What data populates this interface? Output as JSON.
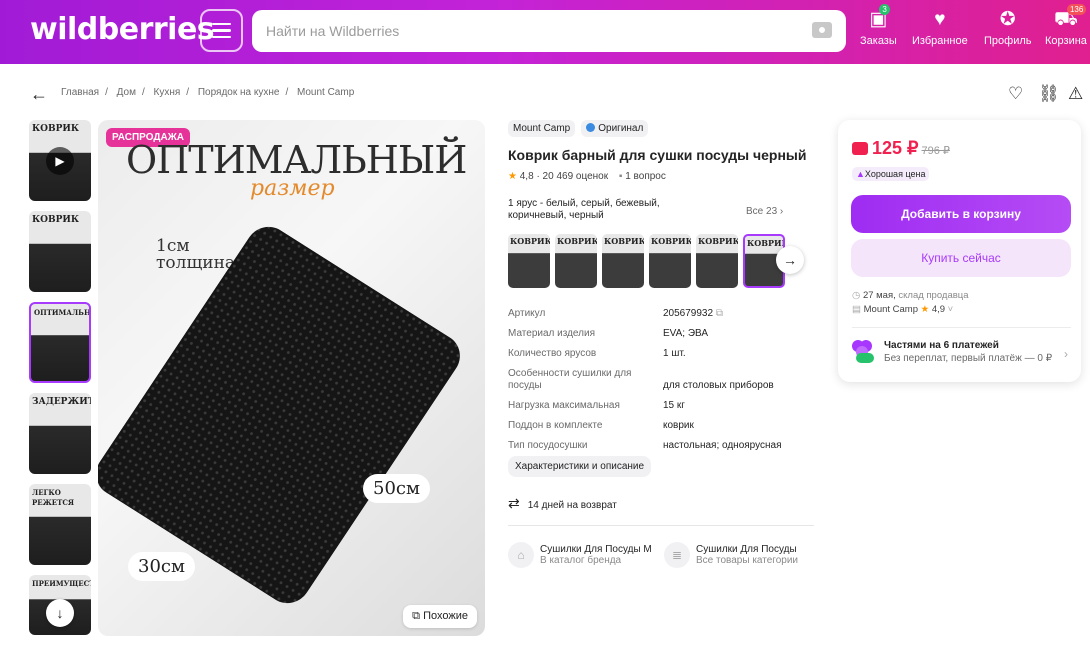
{
  "header": {
    "logo": "wildberries",
    "search_placeholder": "Найти на Wildberries",
    "nav": [
      {
        "label": "Заказы",
        "icon": "box-icon",
        "badge": "3"
      },
      {
        "label": "Избранное",
        "icon": "heart-icon",
        "badge": ""
      },
      {
        "label": "Профиль",
        "icon": "profile-icon",
        "badge": ""
      },
      {
        "label": "Корзина",
        "icon": "cart-icon",
        "badge": "136"
      }
    ]
  },
  "breadcrumbs": [
    "Главная",
    "/",
    "Дом",
    "/",
    "Кухня",
    "/",
    "Порядок на кухне",
    "/",
    "Mount Camp"
  ],
  "gallery": {
    "sale_label": "РАСПРОДАЖА",
    "heading": "ОПТИМАЛЬНЫЙ",
    "subheading": "размер",
    "thickness": "1см",
    "thickness_label": "толщина",
    "dim_long": "50см",
    "dim_short": "30см",
    "similar_label": "Похожие",
    "thumbs": [
      "КОВРИК",
      "КОВРИК",
      "ОПТИМАЛЬНЫЙ",
      "ЗАДЕРЖИТ",
      "ЛЕГКО РЕЖЕТСЯ",
      "ПРЕИМУЩЕСТВА"
    ]
  },
  "product": {
    "brand": "Mount Camp",
    "original": "Оригинал",
    "title": "Коврик барный для сушки посуды черный",
    "rating": "4,8",
    "reviews": "· 20 469 оценок",
    "questions": "1 вопрос",
    "color_text": "1 ярус - белый, серый, бежевый, коричневый, черный",
    "all_variants": "Все 23",
    "variant_labels": [
      "КОВРИК",
      "КОВРИК",
      "КОВРИК",
      "КОВРИК",
      "КОВРИК",
      "КОВРИК"
    ],
    "specs": [
      {
        "k": "Артикул",
        "v": "205679932"
      },
      {
        "k": "Материал изделия",
        "v": "EVA; ЭВА"
      },
      {
        "k": "Количество ярусов",
        "v": "1 шт."
      },
      {
        "k": "Особенности сушилки для посуды",
        "v": "для столовых приборов"
      },
      {
        "k": "Нагрузка максимальная",
        "v": "15 кг"
      },
      {
        "k": "Поддон в комплекте",
        "v": "коврик"
      },
      {
        "k": "Тип посудосушки",
        "v": "настольная; одноярусная"
      }
    ],
    "specs_button": "Характеристики и описание",
    "return_text": "14 дней на возврат",
    "links": [
      {
        "t1": "Сушилки Для Посуды Mount Camp",
        "t2": "В каталог бренда"
      },
      {
        "t1": "Сушилки Для Посуды",
        "t2": "Все товары категории"
      }
    ]
  },
  "buy": {
    "price": "125 ₽",
    "old_price": "796 ₽",
    "good_price": "Хорошая цена",
    "add_to_cart": "Добавить в корзину",
    "buy_now": "Купить сейчас",
    "delivery_date": "27 мая,",
    "delivery_src": "склад продавца",
    "seller": "Mount Camp",
    "seller_rating": "4,9",
    "installments_title": "Частями на 6 платежей",
    "installments_sub": "Без переплат, первый платёж — 0 ₽"
  },
  "colors": {
    "accent": "#a73afd",
    "price": "#f0214f",
    "header_from": "#a11bd6",
    "header_to": "#e0208f"
  }
}
